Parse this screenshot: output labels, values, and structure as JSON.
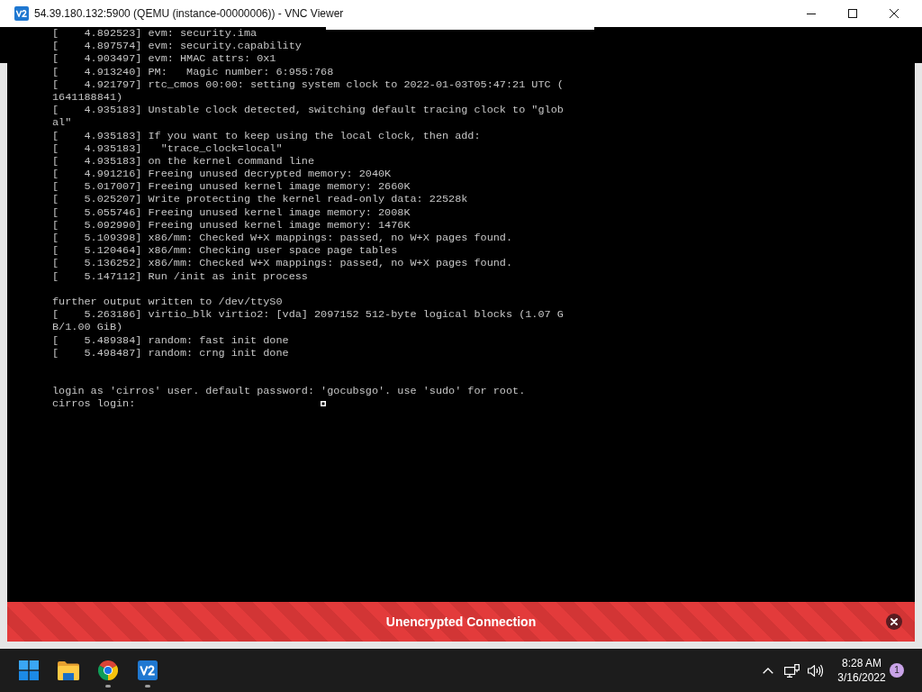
{
  "window": {
    "title": "54.39.180.132:5900 (QEMU (instance-00000006)) - VNC Viewer"
  },
  "console": {
    "lines": [
      {
        "kind": "text",
        "text": "[    4.892523] evm: security.ima"
      },
      {
        "kind": "text",
        "text": "[    4.897574] evm: security.capability"
      },
      {
        "kind": "text",
        "text": "[    4.903497] evm: HMAC attrs: 0x1"
      },
      {
        "kind": "text",
        "text": "[    4.913240] PM:   Magic number: 6:955:768"
      },
      {
        "kind": "text",
        "text": "[    4.921797] rtc_cmos 00:00: setting system clock to 2022-01-03T05:47:21 UTC ("
      },
      {
        "kind": "text",
        "text": "1641188841)"
      },
      {
        "kind": "text",
        "text": "[    4.935183] Unstable clock detected, switching default tracing clock to \"glob"
      },
      {
        "kind": "text",
        "text": "al\""
      },
      {
        "kind": "text",
        "text": "[    4.935183] If you want to keep using the local clock, then add:"
      },
      {
        "kind": "text",
        "text": "[    4.935183]   \"trace_clock=local\""
      },
      {
        "kind": "text",
        "text": "[    4.935183] on the kernel command line"
      },
      {
        "kind": "text",
        "text": "[    4.991216] Freeing unused decrypted memory: 2040K"
      },
      {
        "kind": "text",
        "text": "[    5.017007] Freeing unused kernel image memory: 2660K"
      },
      {
        "kind": "text",
        "text": "[    5.025207] Write protecting the kernel read-only data: 22528k"
      },
      {
        "kind": "text",
        "text": "[    5.055746] Freeing unused kernel image memory: 2008K"
      },
      {
        "kind": "text",
        "text": "[    5.092990] Freeing unused kernel image memory: 1476K"
      },
      {
        "kind": "text",
        "text": "[    5.109398] x86/mm: Checked W+X mappings: passed, no W+X pages found."
      },
      {
        "kind": "text",
        "text": "[    5.120464] x86/mm: Checking user space page tables"
      },
      {
        "kind": "text",
        "text": "[    5.136252] x86/mm: Checked W+X mappings: passed, no W+X pages found."
      },
      {
        "kind": "text",
        "text": "[    5.147112] Run /init as init process"
      },
      {
        "kind": "blank"
      },
      {
        "kind": "text",
        "text": "further output written to /dev/ttyS0"
      },
      {
        "kind": "text",
        "text": "[    5.263186] virtio_blk virtio2: [vda] 2097152 512-byte logical blocks (1.07 G"
      },
      {
        "kind": "text",
        "text": "B/1.00 GiB)"
      },
      {
        "kind": "text",
        "text": "[    5.489384] random: fast init done"
      },
      {
        "kind": "text",
        "text": "[    5.498487] random: crng init done"
      },
      {
        "kind": "blank"
      },
      {
        "kind": "blank"
      },
      {
        "kind": "text",
        "text": "login as 'cirros' user. default password: 'gocubsgo'. use 'sudo' for root."
      },
      {
        "kind": "text",
        "text": "cirros login:"
      }
    ]
  },
  "banner": {
    "text": "Unencrypted Connection"
  },
  "taskbar": {
    "apps": [
      {
        "kind": "start",
        "running": false
      },
      {
        "kind": "files",
        "running": false
      },
      {
        "kind": "browser",
        "running": true
      },
      {
        "kind": "viewer",
        "running": true
      }
    ],
    "clock": {
      "time": "8:28 AM",
      "date": "3/16/2022"
    },
    "notifications": {
      "count": "1"
    }
  }
}
